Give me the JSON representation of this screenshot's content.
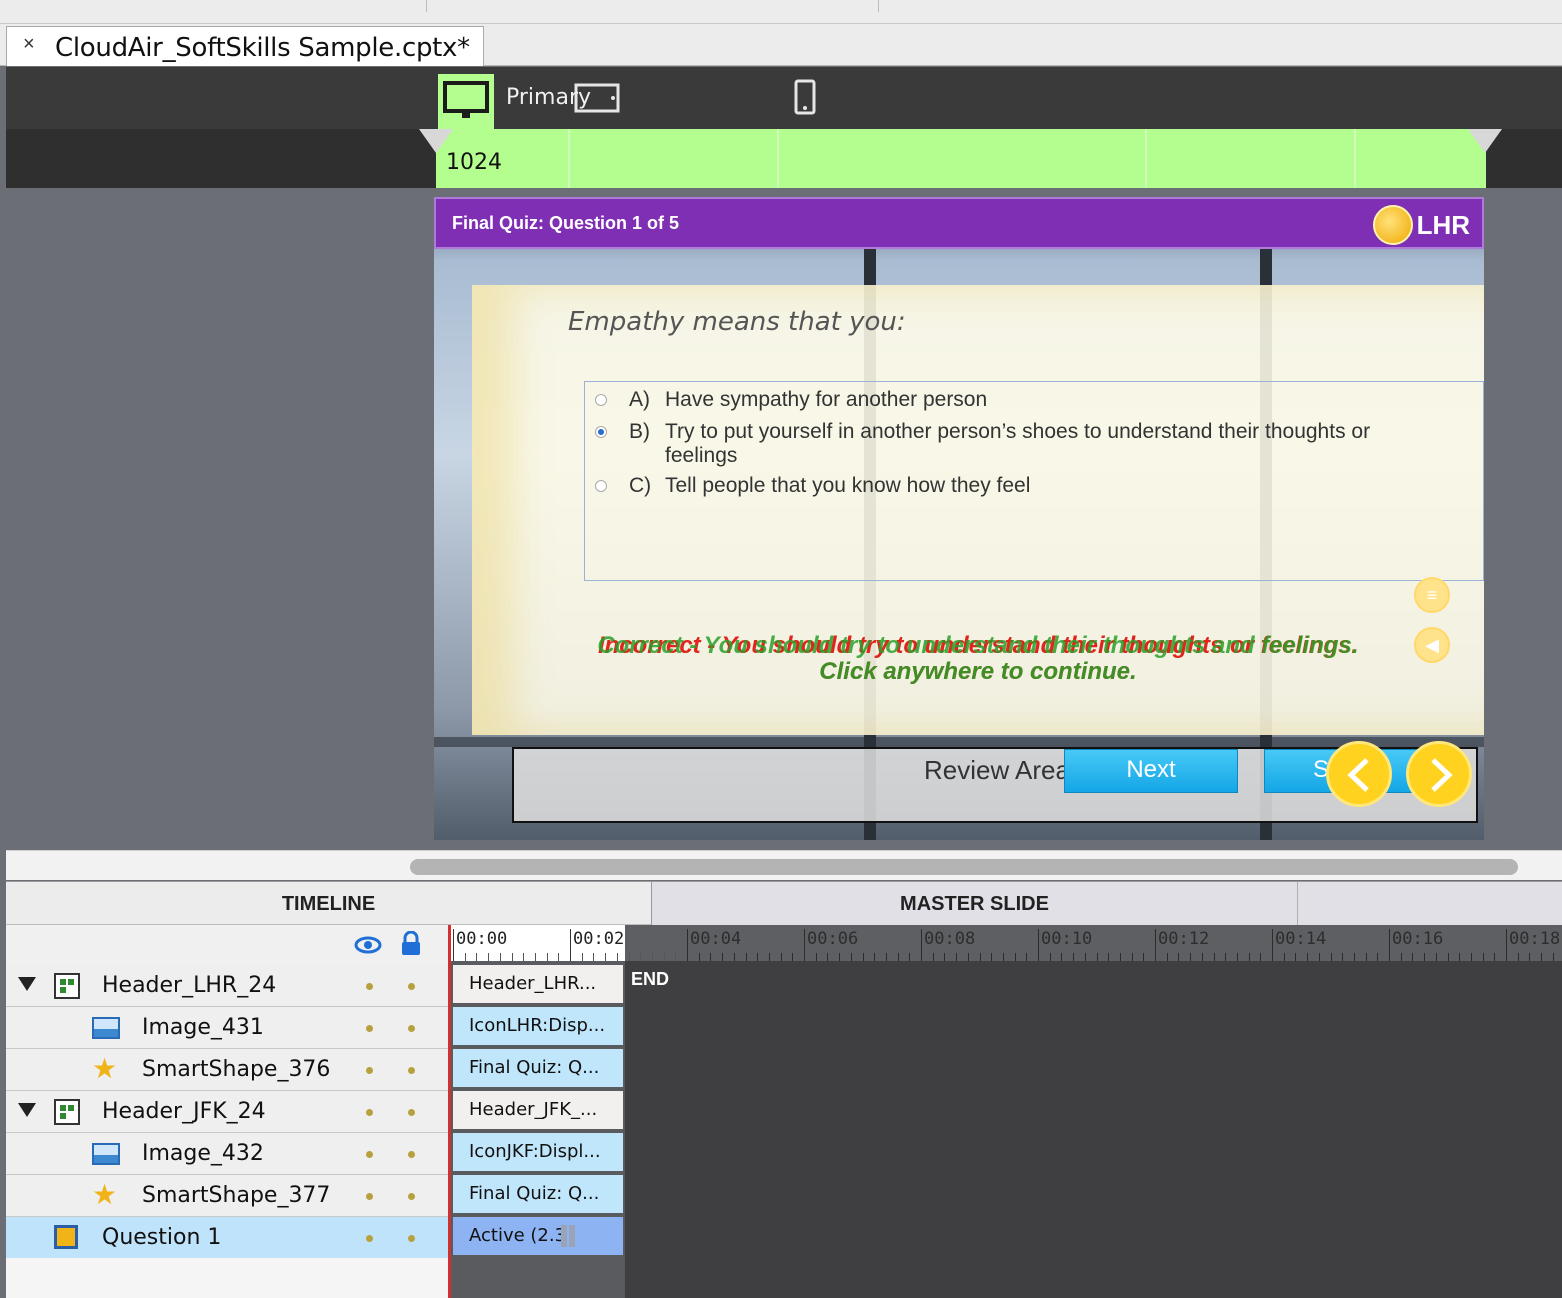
{
  "document": {
    "tab_title": "CloudAir_SoftSkills Sample.cptx*",
    "close_glyph": "×"
  },
  "device_bar": {
    "primary_label": "Primary",
    "breakpoint_width": "1024"
  },
  "slide": {
    "header_title": "Final Quiz: Question 1 of 5",
    "header_code": "LHR",
    "question": "Empathy means that you:",
    "options": [
      {
        "letter": "A)",
        "text": "Have sympathy for another person",
        "selected": false
      },
      {
        "letter": "B)",
        "text": "Try to put yourself in another person’s shoes to understand their thoughts or feelings",
        "selected": true
      },
      {
        "letter": "C)",
        "text": "Tell people that you know how they feel",
        "selected": false
      }
    ],
    "feedback_incorrect": "Incorrect - You should try to understand their thoughts or feelings.",
    "feedback_correct": "Correct - You should try to understand their thoughts and feelings.",
    "feedback_continue": "Click anywhere to continue.",
    "review_area": "Review Area",
    "next_label": "Next",
    "submit_label": "S"
  },
  "timeline": {
    "title": "TIMELINE",
    "master_title": "MASTER SLIDE",
    "end_label": "END",
    "ruler": [
      "00:00",
      "00:02",
      "00:04",
      "00:06",
      "00:08",
      "00:10",
      "00:12",
      "00:14",
      "00:16",
      "00:18"
    ],
    "layers": [
      {
        "name": "Header_LHR_24",
        "icon": "group-icon",
        "expandable": true,
        "clip": "Header_LHR...",
        "clip_style": "plain"
      },
      {
        "name": "Image_431",
        "icon": "image-icon",
        "expandable": false,
        "clip": "IconLHR:Disp...",
        "clip_style": "blue"
      },
      {
        "name": "SmartShape_376",
        "icon": "star-icon",
        "expandable": false,
        "clip": "Final Quiz: Q...",
        "clip_style": "blue"
      },
      {
        "name": "Header_JFK_24",
        "icon": "group-icon",
        "expandable": true,
        "clip": "Header_JFK_...",
        "clip_style": "plain"
      },
      {
        "name": "Image_432",
        "icon": "image-icon",
        "expandable": false,
        "clip": "IconJKF:Displ...",
        "clip_style": "blue"
      },
      {
        "name": "SmartShape_377",
        "icon": "star-icon",
        "expandable": false,
        "clip": "Final Quiz: Q...",
        "clip_style": "blue"
      },
      {
        "name": "Question 1",
        "icon": "quiz-icon",
        "expandable": false,
        "clip": "Active (2.3",
        "clip_style": "active"
      }
    ]
  },
  "colors": {
    "breakpoint_green": "#b4fe8f",
    "header_purple": "#7f2fb3",
    "button_blue": "#13a6e6",
    "nav_yellow": "#ffd21f",
    "selected_row": "#bfe3fb"
  }
}
